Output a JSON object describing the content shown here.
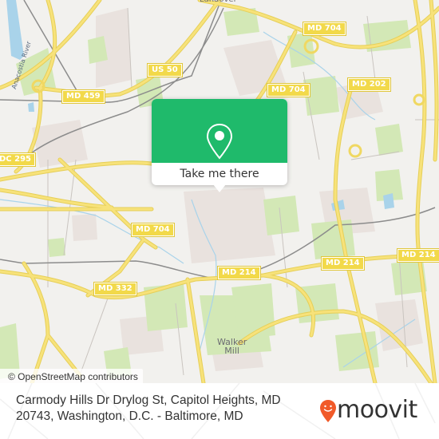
{
  "map": {
    "attribution": "© OpenStreetMap contributors",
    "road_labels": [
      {
        "id": "us-50",
        "text": "US 50"
      },
      {
        "id": "md-459",
        "text": "MD 459"
      },
      {
        "id": "md-704-north",
        "text": "MD 704"
      },
      {
        "id": "md-704-mid",
        "text": "MD 704"
      },
      {
        "id": "md-704-west",
        "text": "MD 704"
      },
      {
        "id": "md-202",
        "text": "MD 202"
      },
      {
        "id": "dc-295",
        "text": "DC 295"
      },
      {
        "id": "md-214-west",
        "text": "MD 214"
      },
      {
        "id": "md-214-center",
        "text": "MD 214"
      },
      {
        "id": "md-214-east",
        "text": "MD 214"
      },
      {
        "id": "md-332",
        "text": "MD 332"
      }
    ],
    "places": [
      {
        "id": "walker-mill",
        "line1": "Walker",
        "line2": "Mill"
      },
      {
        "id": "landover",
        "text": "Landover"
      }
    ],
    "water_labels": [
      {
        "id": "anacostia-river",
        "text": "Anacostia River"
      }
    ],
    "colors": {
      "background": "#f2f1ee",
      "road": "#f7e27a",
      "park": "#d2e8b4",
      "residential": "#e8e0dc",
      "water": "#a9d3ea",
      "rail": "#8c8c8c",
      "shield": "#f2d94a"
    }
  },
  "popup": {
    "icon": "location-pin-icon",
    "button_label": "Take me there",
    "color": "#1fba6b"
  },
  "footer": {
    "address_line1": "Carmody Hills Dr Drylog St, Capitol Heights, MD",
    "address_line2": "20743, Washington, D.C. - Baltimore, MD",
    "brand": "moovit",
    "brand_color": "#f15a29"
  }
}
